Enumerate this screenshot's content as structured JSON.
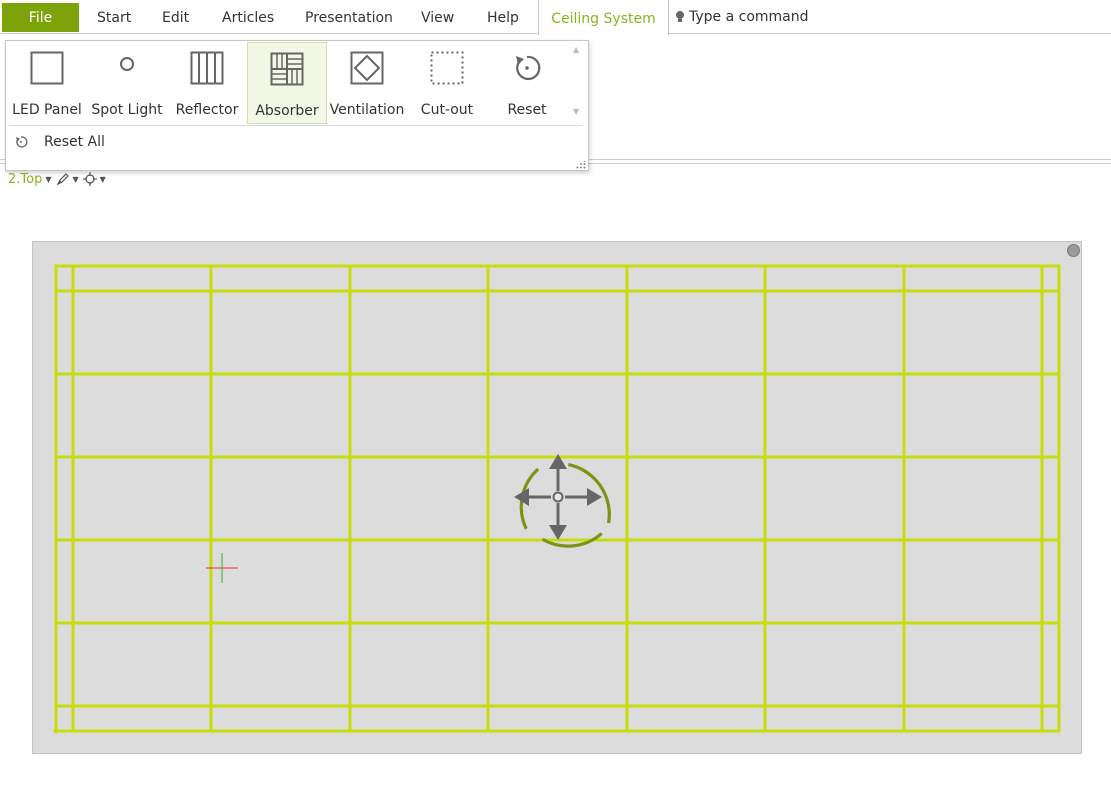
{
  "menubar": {
    "file": "File",
    "items": [
      "Start",
      "Edit",
      "Articles",
      "Presentation",
      "View",
      "Help"
    ],
    "context_tab": "Ceiling System",
    "command_placeholder": "Type a command"
  },
  "panel": {
    "tools": [
      {
        "label": "LED Panel",
        "icon": "led-panel-icon",
        "active": false
      },
      {
        "label": "Spot Light",
        "icon": "spot-light-icon",
        "active": false
      },
      {
        "label": "Reflector",
        "icon": "reflector-icon",
        "active": false
      },
      {
        "label": "Absorber",
        "icon": "absorber-icon",
        "active": true
      },
      {
        "label": "Ventilation",
        "icon": "ventilation-icon",
        "active": false
      },
      {
        "label": "Cut-out",
        "icon": "cut-out-icon",
        "active": false
      },
      {
        "label": "Reset",
        "icon": "reset-icon",
        "active": false
      }
    ],
    "reset_all": "Reset All"
  },
  "viewbar": {
    "view_name": "2.Top"
  },
  "colors": {
    "accent": "#7da30b",
    "tab_text": "#8cb21c",
    "grid_line": "#c6dd0b",
    "canvas_bg": "#dcdcdc",
    "move_ring": "#7a9416",
    "move_arrows": "#666666"
  }
}
